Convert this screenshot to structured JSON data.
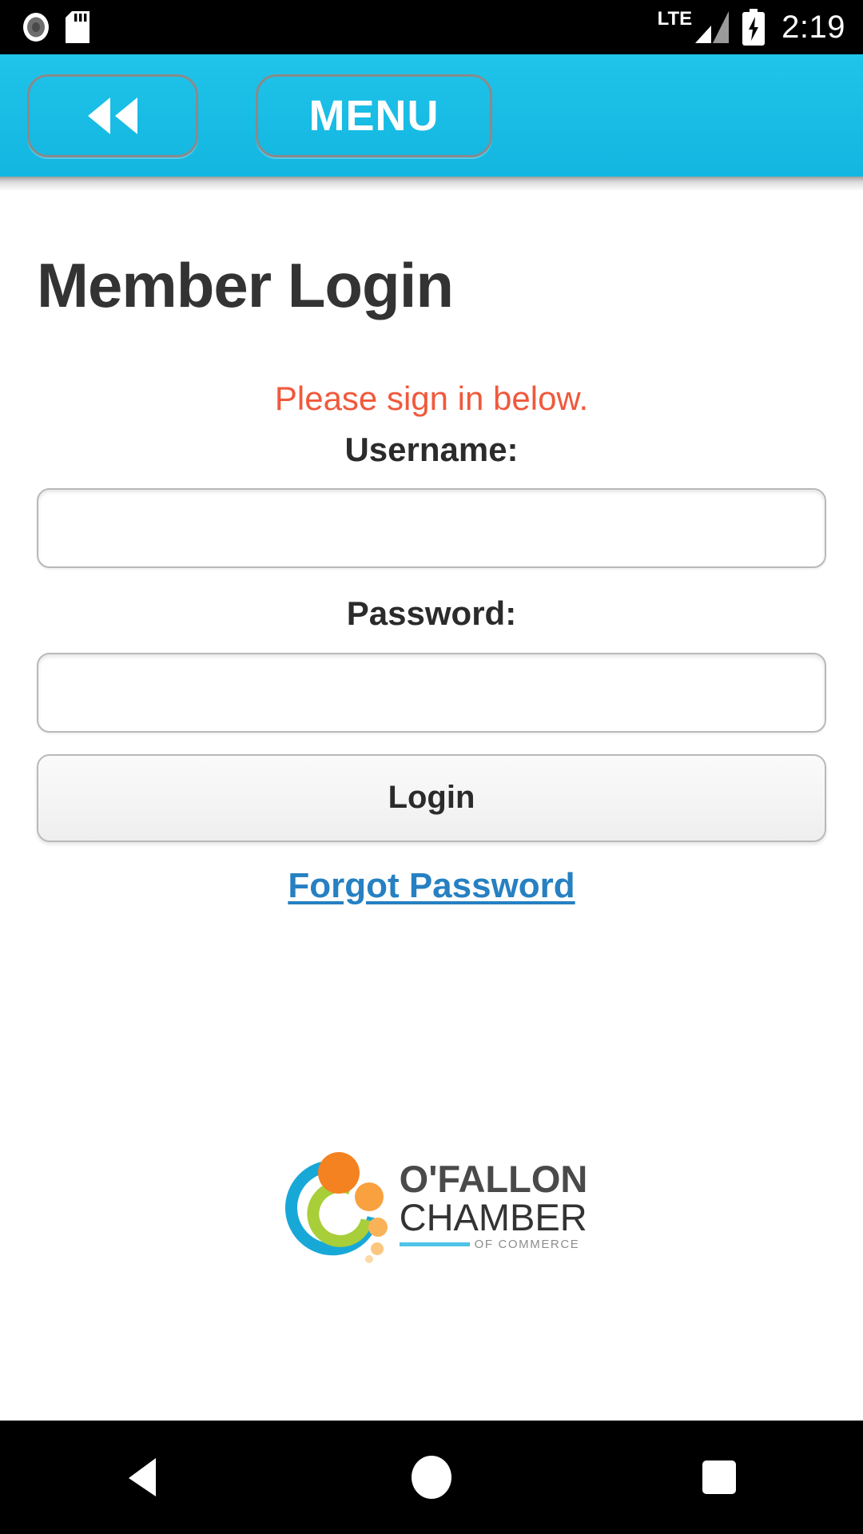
{
  "status_bar": {
    "icons": [
      "camera-dot-icon",
      "sd-card-icon"
    ],
    "network_label": "LTE",
    "signal_icon": "signal-bars-icon",
    "battery_icon": "battery-charging-icon",
    "time": "2:19"
  },
  "header": {
    "back_label": "<<",
    "menu_label": "MENU",
    "background_color": "#18BCE4",
    "border_color": "#8a8a8a"
  },
  "main": {
    "page_title": "Member Login",
    "signin_message": "Please sign in below.",
    "signin_message_color": "#F0593C",
    "username_label": "Username:",
    "username_value": "",
    "username_placeholder": "",
    "password_label": "Password:",
    "password_value": "",
    "password_placeholder": "",
    "login_button_label": "Login",
    "forgot_password_label": "Forgot Password",
    "link_color": "#2680C2"
  },
  "logo": {
    "line1": "O'FALLON",
    "line2": "CHAMBER",
    "line3": "OF COMMERCE",
    "arc_outer_color": "#18A8D8",
    "arc_inner_color": "#A8CE39",
    "dot_colors": [
      "#F58220",
      "#F9A03F",
      "#FAB259",
      "#FBC77E",
      "#FCD9A6"
    ],
    "rule_color": "#4FC3E8"
  },
  "nav_bar": {
    "back_icon": "triangle-back-icon",
    "home_icon": "circle-home-icon",
    "recents_icon": "square-recents-icon"
  }
}
